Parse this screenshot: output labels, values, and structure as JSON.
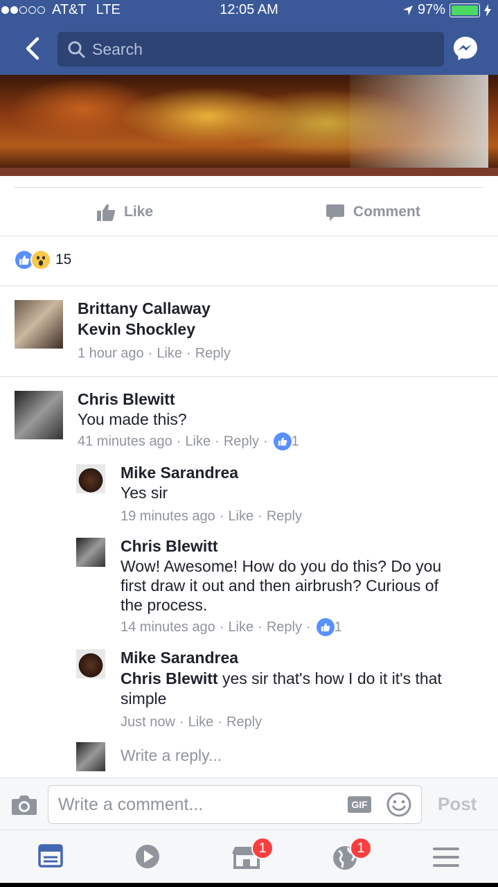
{
  "status_bar": {
    "carrier": "AT&T",
    "network": "LTE",
    "time": "12:05 AM",
    "battery": "97%",
    "battery_level": 0.97
  },
  "nav": {
    "search_placeholder": "Search"
  },
  "post_actions": {
    "like_label": "Like",
    "comment_label": "Comment"
  },
  "reactions": {
    "count": "15"
  },
  "comments": [
    {
      "author": "Brittany Callaway",
      "text": "Kevin Shockley",
      "time": "1 hour ago",
      "like": "Like",
      "reply": "Reply"
    },
    {
      "author": "Chris Blewitt",
      "text": "You made this?",
      "time": "41 minutes ago",
      "like": "Like",
      "reply": "Reply",
      "likes": "1",
      "replies": [
        {
          "author": "Mike Sarandrea",
          "text": "Yes sir",
          "time": "19 minutes ago",
          "like": "Like",
          "reply": "Reply"
        },
        {
          "author": "Chris Blewitt",
          "text_line1": "Wow! Awesome! How do you do this? Do you",
          "text_line2": "first draw it out and then airbrush? Curious of",
          "text_line3": "the process.",
          "time": "14 minutes ago",
          "like": "Like",
          "reply": "Reply",
          "likes": "1"
        },
        {
          "author": "Mike Sarandrea",
          "mention": "Chris Blewitt",
          "text_line1": " yes sir that's how I do it it's that",
          "text_line2": "simple",
          "time": "Just now",
          "like": "Like",
          "reply": "Reply"
        }
      ],
      "write_reply_placeholder": "Write a reply..."
    }
  ],
  "composer": {
    "placeholder": "Write a comment...",
    "gif_label": "GIF",
    "post_label": "Post"
  },
  "tabbar": {
    "marketplace_badge": "1",
    "notifications_badge": "1"
  },
  "colors": {
    "brand": "#3b5998",
    "like_blue": "#5890ff",
    "badge_red": "#fa3e3e"
  }
}
